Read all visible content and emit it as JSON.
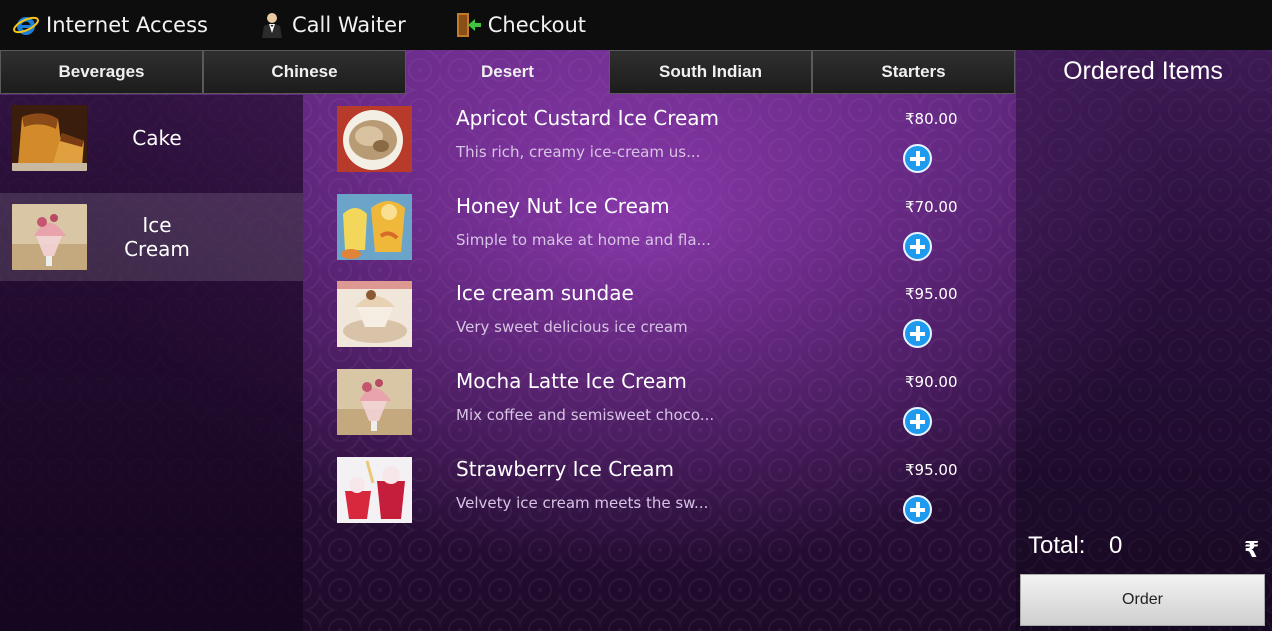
{
  "topbar": {
    "items": [
      {
        "label": "Internet Access",
        "icon": "internet-explorer-icon"
      },
      {
        "label": "Call Waiter",
        "icon": "waiter-icon"
      },
      {
        "label": "Checkout",
        "icon": "door-exit-icon"
      }
    ]
  },
  "tabs": [
    {
      "label": "Beverages",
      "active": false
    },
    {
      "label": "Chinese",
      "active": false
    },
    {
      "label": "Desert",
      "active": true
    },
    {
      "label": "South Indian",
      "active": false
    },
    {
      "label": "Starters",
      "active": false
    }
  ],
  "categories": [
    {
      "label": "Cake",
      "selected": false
    },
    {
      "label": "Ice Cream",
      "selected": true
    }
  ],
  "items": [
    {
      "name": "Apricot Custard Ice Cream",
      "desc": "This rich, creamy ice-cream us...",
      "price": "₹80.00"
    },
    {
      "name": "Honey Nut Ice Cream",
      "desc": "Simple to make at home and fla...",
      "price": "₹70.00"
    },
    {
      "name": "Ice cream sundae",
      "desc": "Very sweet delicious ice cream",
      "price": "₹95.00"
    },
    {
      "name": "Mocha Latte Ice Cream",
      "desc": "Mix coffee and semisweet choco...",
      "price": "₹90.00"
    },
    {
      "name": "Strawberry Ice Cream",
      "desc": "Velvety ice cream meets the sw...",
      "price": "₹95.00"
    }
  ],
  "order_panel": {
    "title": "Ordered Items",
    "total_label": "Total:",
    "total_value": "0",
    "currency_symbol": "₹",
    "order_button": "Order"
  },
  "colors": {
    "accent_blue": "#1e9bef",
    "tab_dark": "#1c1c1c",
    "topbar": "#0d0d0d",
    "purple": "#5a2578"
  }
}
